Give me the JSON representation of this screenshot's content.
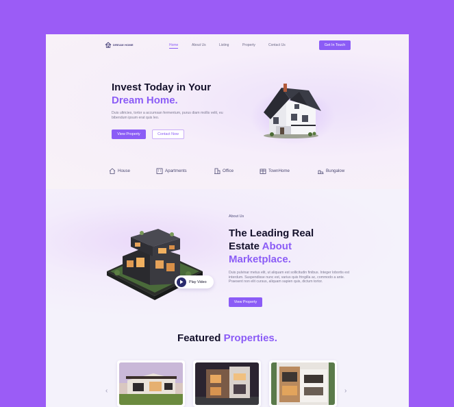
{
  "colors": {
    "background": "#9b5cf6",
    "accent": "#8b5cf6",
    "heading": "#14112b",
    "text": "#7b7890"
  },
  "logo": {
    "text": "DREAM HOME",
    "icon": "house-logo-icon"
  },
  "nav": {
    "items": [
      "Home",
      "About Us",
      "Listing",
      "Property",
      "Contact Us"
    ],
    "active": "Home",
    "cta": "Get In Touch"
  },
  "hero": {
    "title_line1": "Invest Today in Your",
    "title_line2": "Dream Home.",
    "description": "Duis ultricies, tortor a accumsan fermentum, purus diam mollis velit, eu bibendum ipsum erat quis leo.",
    "primary_button": "View Property",
    "secondary_button": "Contact Now"
  },
  "categories": [
    {
      "label": "House",
      "icon": "house-icon"
    },
    {
      "label": "Apartments",
      "icon": "apartments-icon"
    },
    {
      "label": "Office",
      "icon": "office-icon"
    },
    {
      "label": "TownHome",
      "icon": "townhome-icon"
    },
    {
      "label": "Bungalow",
      "icon": "bungalow-icon"
    }
  ],
  "about": {
    "kicker": "About Us",
    "title_line1": "The Leading Real",
    "title_line2": "Estate ",
    "title_accent2": "About",
    "title_accent3": "Marketplace.",
    "description": "Duis pulvinar metus elit, ut aliquam est sollicitudin finibus. Integer lobortis est interdum. Suspendisse nunc est, varius quis fringilla ac, commodo a ante. Praesent non elit cursus, aliquam sapien quis, dictum tortor.",
    "button": "View Property",
    "play_label": "Play Video"
  },
  "featured": {
    "title": "Featured ",
    "title_accent": "Properties.",
    "prev": "‹",
    "next": "›"
  }
}
